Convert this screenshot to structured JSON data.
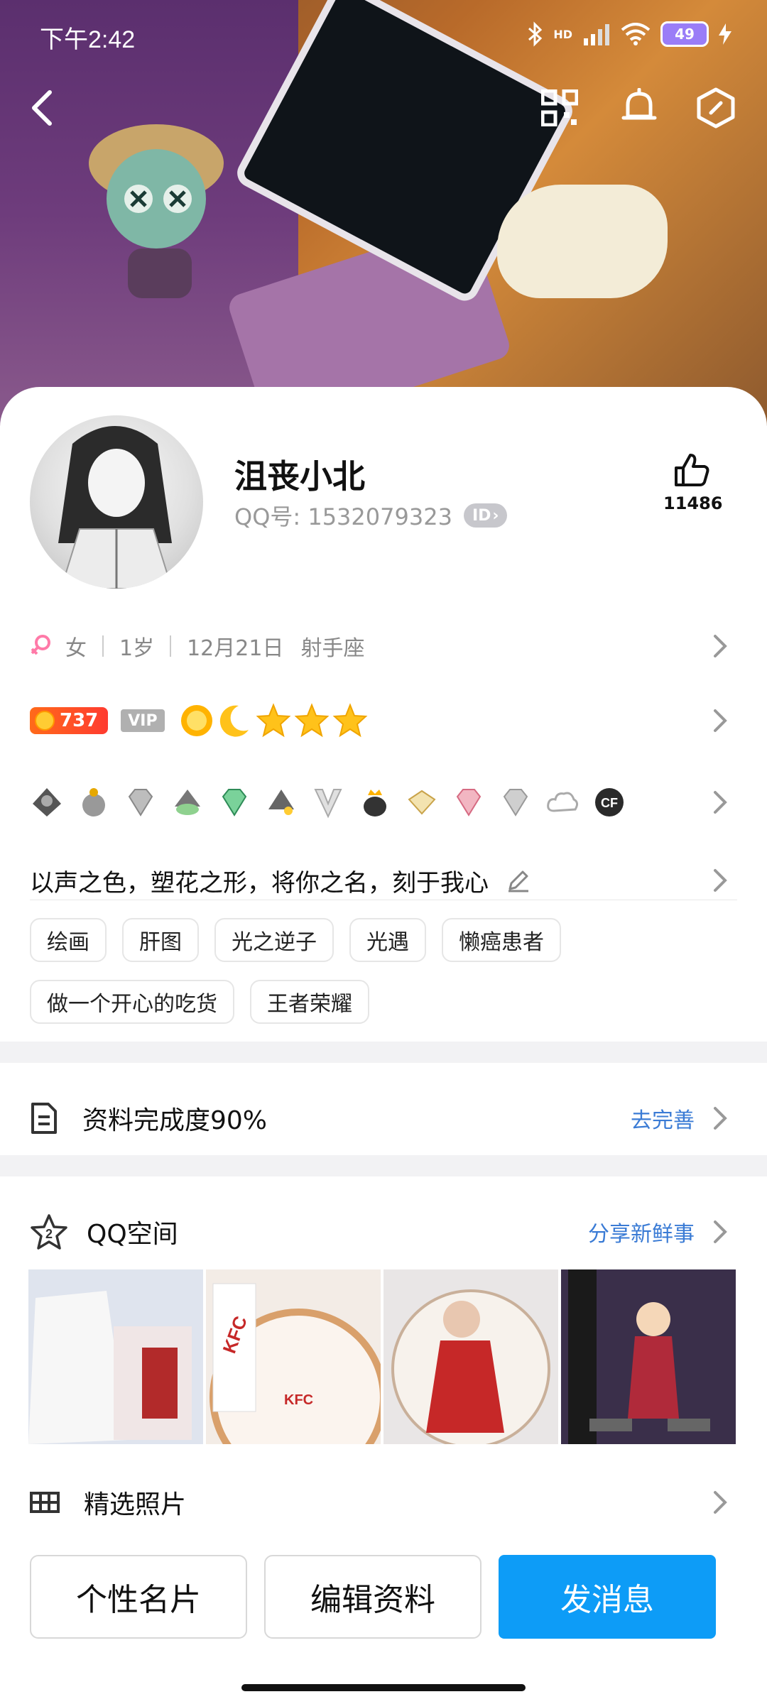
{
  "status_bar": {
    "time": "下午2:42",
    "network": "HD",
    "battery": "49"
  },
  "profile": {
    "nickname": "沮丧小北",
    "qq_label": "QQ号: 1532079323",
    "id_badge": "ID",
    "likes": "11486"
  },
  "info": {
    "gender": "女",
    "age": "1岁",
    "birthday": "12月21日",
    "constellation": "射手座"
  },
  "level": {
    "value": "737",
    "vip": "VIP"
  },
  "badges": [
    "badge-penguin-gray-icon",
    "badge-penguin-hat-icon",
    "badge-diamond-gray-icon",
    "badge-penguin-green-icon",
    "badge-diamond-green-icon",
    "badge-penguin-star-icon",
    "badge-v-icon",
    "badge-penguin-crown-icon",
    "badge-diamond-gold-icon",
    "badge-diamond-pink-icon",
    "badge-diamond-silver-icon",
    "badge-cloud-v-icon",
    "badge-cf-icon"
  ],
  "signature": "以声之色，塑花之形，将你之名，刻于我心",
  "tags": {
    "row1": [
      "绘画",
      "肝图",
      "光之逆子",
      "光遇",
      "懒癌患者"
    ],
    "row2": [
      "做一个开心的吃货",
      "王者荣耀"
    ]
  },
  "completion": {
    "label": "资料完成度90%",
    "action": "去完善"
  },
  "qzone": {
    "label": "QQ空间",
    "action": "分享新鲜事",
    "level": "2"
  },
  "photos": {
    "label": "精选照片"
  },
  "bottom": {
    "card": "个性名片",
    "edit": "编辑资料",
    "message": "发消息"
  },
  "colors": {
    "accent": "#0d9cf7",
    "link": "#3a7bd5",
    "level": "#ff3b30",
    "vip": "#b0b0b0"
  }
}
